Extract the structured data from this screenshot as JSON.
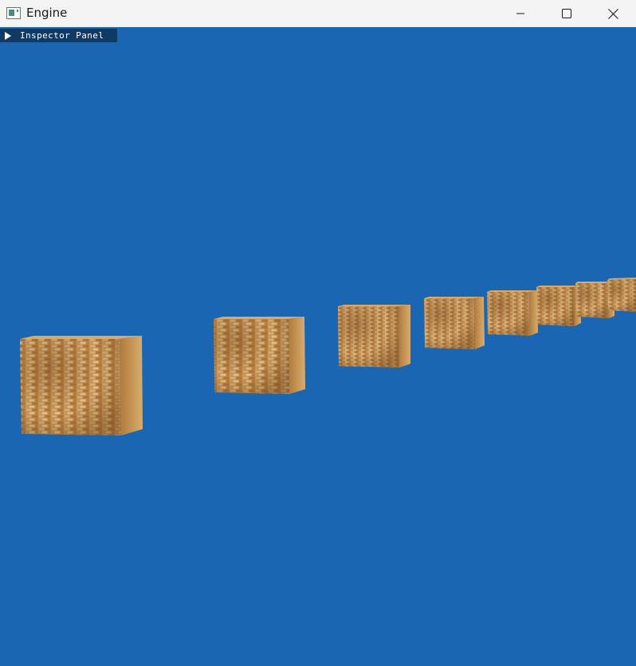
{
  "window": {
    "title": "Engine",
    "icon": "app-window-icon",
    "controls": [
      "minimize-icon",
      "maximize-icon",
      "close-icon"
    ]
  },
  "inspector": {
    "label": "Inspector Panel",
    "state": "collapsed",
    "icon": "triangle-right-icon"
  },
  "viewport": {
    "background_color": "#1a66b3",
    "object_texture": "brick",
    "object_count": 8
  },
  "colors": {
    "titlebar": "#f3f3f3",
    "inspector_background": "#0f3a66",
    "brick_light": "#d9ad6f",
    "brick_dark": "#8a5a25"
  }
}
